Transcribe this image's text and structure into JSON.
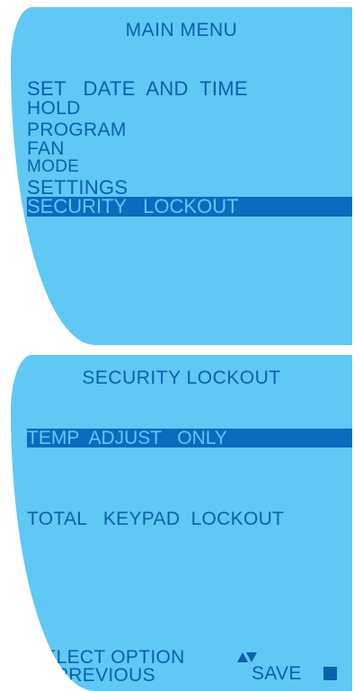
{
  "main_menu": {
    "title": "MAIN MENU",
    "items": [
      {
        "label": "SET   DATE  AND  TIME"
      },
      {
        "label": "HOLD"
      },
      {
        "label": "PROGRAM"
      },
      {
        "label": "FAN"
      },
      {
        "label": "MODE"
      },
      {
        "label": "SETTINGS"
      },
      {
        "label": "SECURITY   LOCKOUT",
        "selected": true
      }
    ]
  },
  "security_lockout": {
    "title": "SECURITY LOCKOUT",
    "options": [
      {
        "label": "TEMP  ADJUST   ONLY",
        "selected": true
      },
      {
        "label": "TOTAL   KEYPAD  LOCKOUT"
      }
    ],
    "footer": {
      "select_option_label": "SELECT OPTION",
      "previous_label": "PREVIOUS",
      "save_label": "SAVE"
    }
  },
  "colors": {
    "screen_background": "#5fc8f5",
    "text": "#0e5faa",
    "highlight": "#0a6bbf"
  }
}
